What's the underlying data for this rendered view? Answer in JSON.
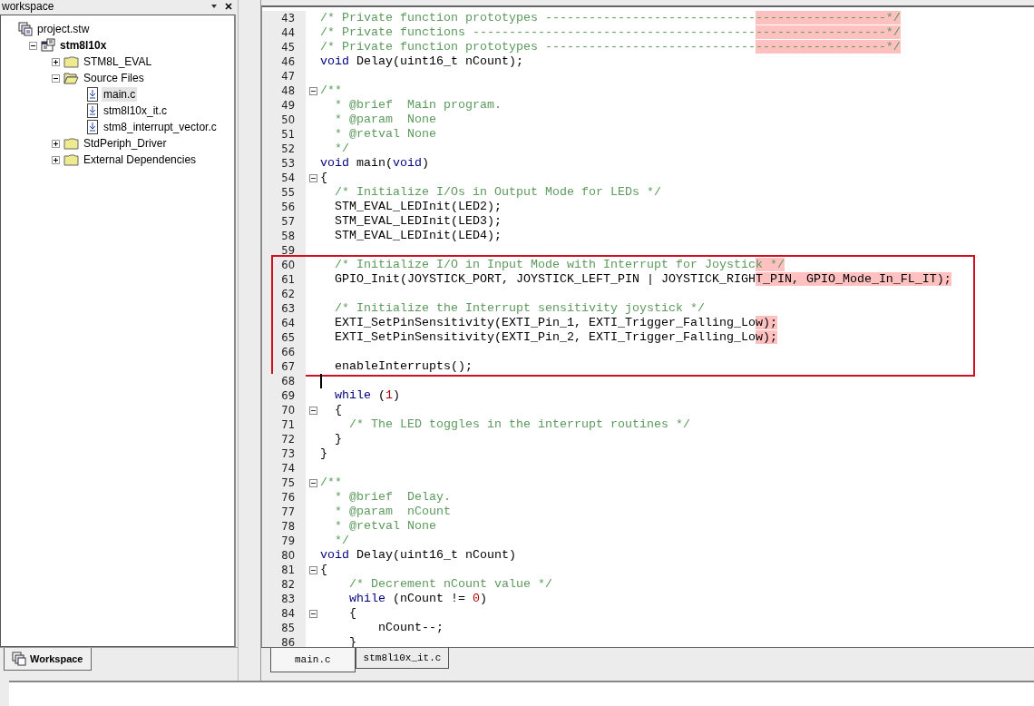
{
  "workspace_panel": {
    "title": "workspace",
    "tree": [
      {
        "label": "project.stw",
        "kind": "workspace",
        "selected": false,
        "children": [
          {
            "label": "stm8l10x",
            "kind": "project",
            "expanded": true,
            "selected": false,
            "children": [
              {
                "label": "STM8L_EVAL",
                "kind": "folder",
                "expanded": false,
                "selected": false
              },
              {
                "label": "Source Files",
                "kind": "folder",
                "expanded": true,
                "selected": false,
                "children": [
                  {
                    "label": "main.c",
                    "kind": "file",
                    "selected": true
                  },
                  {
                    "label": "stm8l10x_it.c",
                    "kind": "file",
                    "selected": false
                  },
                  {
                    "label": "stm8_interrupt_vector.c",
                    "kind": "file",
                    "selected": false
                  }
                ]
              },
              {
                "label": "StdPeriph_Driver",
                "kind": "folder",
                "expanded": false,
                "selected": false
              },
              {
                "label": "External Dependencies",
                "kind": "folder",
                "expanded": false,
                "selected": false
              }
            ]
          }
        ]
      }
    ],
    "tab": "Workspace"
  },
  "editor": {
    "lines": [
      {
        "number": "43",
        "segments": [
          {
            "kind": "comment",
            "text": "/* Private function prototypes -----------------------------------------------*/"
          }
        ]
      },
      {
        "number": "44",
        "segments": [
          {
            "kind": "comment",
            "text": "/* Private functions ---------------------------------------------------------*/"
          }
        ]
      },
      {
        "number": "45",
        "segments": [
          {
            "kind": "comment",
            "text": "/* Private function prototypes -----------------------------------------------*/"
          }
        ]
      },
      {
        "number": "46",
        "segments": [
          {
            "kind": "keyword",
            "text": "void"
          },
          {
            "kind": "plain",
            "text": " Delay(uint16_t nCount);"
          }
        ]
      },
      {
        "number": "47"
      },
      {
        "number": "48",
        "fold_marker": true,
        "segments": [
          {
            "kind": "comment",
            "text": "/**"
          }
        ]
      },
      {
        "number": "49",
        "segments": [
          {
            "kind": "comment",
            "text": "  * @brief  Main program."
          }
        ]
      },
      {
        "number": "50",
        "segments": [
          {
            "kind": "comment",
            "text": "  * @param  None"
          }
        ]
      },
      {
        "number": "51",
        "segments": [
          {
            "kind": "comment",
            "text": "  * @retval None"
          }
        ]
      },
      {
        "number": "52",
        "segments": [
          {
            "kind": "comment",
            "text": "  */"
          }
        ]
      },
      {
        "number": "53",
        "segments": [
          {
            "kind": "keyword",
            "text": "void"
          },
          {
            "kind": "plain",
            "text": " main("
          },
          {
            "kind": "keyword",
            "text": "void"
          },
          {
            "kind": "plain",
            "text": ")"
          }
        ]
      },
      {
        "number": "54",
        "fold_marker": true,
        "segments": [
          {
            "kind": "plain",
            "text": "{"
          }
        ]
      },
      {
        "number": "55",
        "segments": [
          {
            "kind": "comment",
            "text": "  /* Initialize I/Os in Output Mode for LEDs */"
          }
        ]
      },
      {
        "number": "56",
        "segments": [
          {
            "kind": "plain",
            "text": "  STM_EVAL_LEDInit(LED2);"
          }
        ]
      },
      {
        "number": "57",
        "segments": [
          {
            "kind": "plain",
            "text": "  STM_EVAL_LEDInit(LED3);"
          }
        ]
      },
      {
        "number": "58",
        "segments": [
          {
            "kind": "plain",
            "text": "  STM_EVAL_LEDInit(LED4);"
          }
        ]
      },
      {
        "number": "59"
      },
      {
        "number": "60",
        "boxed": true,
        "segments": [
          {
            "kind": "comment",
            "text": "  /* Initialize I/O in Input Mode with Interrupt for Joystick */"
          }
        ]
      },
      {
        "number": "61",
        "boxed": true,
        "segments": [
          {
            "kind": "plain",
            "text": "  GPIO_Init(JOYSTICK_PORT, JOYSTICK_LEFT_PIN | JOYSTICK_RIGHT_PIN, GPIO_Mode_In_FL_IT);"
          }
        ]
      },
      {
        "number": "62",
        "boxed": true
      },
      {
        "number": "63",
        "boxed": true,
        "segments": [
          {
            "kind": "comment",
            "text": "  /* Initialize the Interrupt sensitivity joystick */"
          }
        ]
      },
      {
        "number": "64",
        "boxed": true,
        "segments": [
          {
            "kind": "plain",
            "text": "  EXTI_SetPinSensitivity(EXTI_Pin_1, EXTI_Trigger_Falling_Low);"
          }
        ]
      },
      {
        "number": "65",
        "boxed": true,
        "segments": [
          {
            "kind": "plain",
            "text": "  EXTI_SetPinSensitivity(EXTI_Pin_2, EXTI_Trigger_Falling_Low);"
          }
        ]
      },
      {
        "number": "66",
        "boxed": true
      },
      {
        "number": "67",
        "boxed": true,
        "segments": [
          {
            "kind": "plain",
            "text": "  enableInterrupts();"
          }
        ]
      },
      {
        "number": "68",
        "cursor": true
      },
      {
        "number": "69",
        "segments": [
          {
            "kind": "keyword",
            "text": "  while"
          },
          {
            "kind": "plain",
            "text": " ("
          },
          {
            "kind": "number",
            "text": "1"
          },
          {
            "kind": "plain",
            "text": ")"
          }
        ]
      },
      {
        "number": "70",
        "fold_marker": true,
        "segments": [
          {
            "kind": "plain",
            "text": "  {"
          }
        ]
      },
      {
        "number": "71",
        "segments": [
          {
            "kind": "comment",
            "text": "    /* The LED toggles in the interrupt routines */"
          }
        ]
      },
      {
        "number": "72",
        "segments": [
          {
            "kind": "plain",
            "text": "  }"
          }
        ]
      },
      {
        "number": "73",
        "segments": [
          {
            "kind": "plain",
            "text": "}"
          }
        ]
      },
      {
        "number": "74"
      },
      {
        "number": "75",
        "fold_marker": true,
        "segments": [
          {
            "kind": "comment",
            "text": "/**"
          }
        ]
      },
      {
        "number": "76",
        "segments": [
          {
            "kind": "comment",
            "text": "  * @brief  Delay."
          }
        ]
      },
      {
        "number": "77",
        "segments": [
          {
            "kind": "comment",
            "text": "  * @param  nCount"
          }
        ]
      },
      {
        "number": "78",
        "segments": [
          {
            "kind": "comment",
            "text": "  * @retval None"
          }
        ]
      },
      {
        "number": "79",
        "segments": [
          {
            "kind": "comment",
            "text": "  */"
          }
        ]
      },
      {
        "number": "80",
        "segments": [
          {
            "kind": "keyword",
            "text": "void"
          },
          {
            "kind": "plain",
            "text": " Delay(uint16_t nCount)"
          }
        ]
      },
      {
        "number": "81",
        "fold_marker": true,
        "segments": [
          {
            "kind": "plain",
            "text": "{"
          }
        ]
      },
      {
        "number": "82",
        "segments": [
          {
            "kind": "comment",
            "text": "    /* Decrement nCount value */"
          }
        ]
      },
      {
        "number": "83",
        "segments": [
          {
            "kind": "keyword",
            "text": "    while"
          },
          {
            "kind": "plain",
            "text": " (nCount != "
          },
          {
            "kind": "number",
            "text": "0"
          },
          {
            "kind": "plain",
            "text": ")"
          }
        ]
      },
      {
        "number": "84",
        "fold_marker": true,
        "segments": [
          {
            "kind": "plain",
            "text": "    {"
          }
        ]
      },
      {
        "number": "85",
        "segments": [
          {
            "kind": "plain",
            "text": "        nCount--;"
          }
        ]
      },
      {
        "number": "86",
        "segments": [
          {
            "kind": "plain",
            "text": "    }"
          }
        ]
      }
    ],
    "tabs": [
      {
        "label": "main.c",
        "selected": true
      },
      {
        "label": "stm8l10x_it.c",
        "selected": false
      }
    ]
  }
}
